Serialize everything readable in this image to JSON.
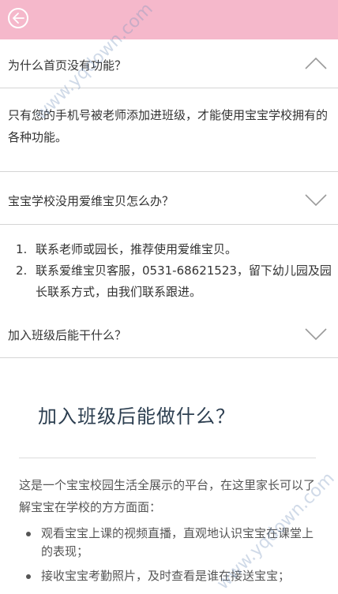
{
  "faq": [
    {
      "question": "为什么首页没有功能？",
      "expanded": true,
      "answer": "只有您的手机号被老师添加进班级，才能使用宝宝学校拥有的各种功能。"
    },
    {
      "question": "宝宝学校没用爱维宝贝怎么办？",
      "expanded": false,
      "answer_items": [
        {
          "num": "1.",
          "text": "联系老师或园长，推荐使用爱维宝贝。"
        },
        {
          "num": "2.",
          "text": "联系爱维宝贝客服，0531-68621523，留下幼儿园及园长联系方式，由我们联系跟进。"
        }
      ]
    },
    {
      "question": "加入班级后能干什么？",
      "expanded": false
    }
  ],
  "card": {
    "title": "加入班级后能做什么？",
    "intro": "这是一个宝宝校园生活全展示的平台，在这里家长可以了解宝宝在学校的方方面面：",
    "bullets": [
      "观看宝宝上课的视频直播，直观地认识宝宝在课堂上的表现；",
      "接收宝宝考勤照片，及时查看是谁在接送宝宝；"
    ]
  },
  "watermark": "www.yqdown.com",
  "colors": {
    "header_bg": "#f5b8cb",
    "divider": "#d5d5d5",
    "title": "#2c3e50"
  },
  "icons": {
    "back": "back-arrow-icon",
    "collapse": "chevron-up-icon",
    "expand": "chevron-down-icon"
  }
}
